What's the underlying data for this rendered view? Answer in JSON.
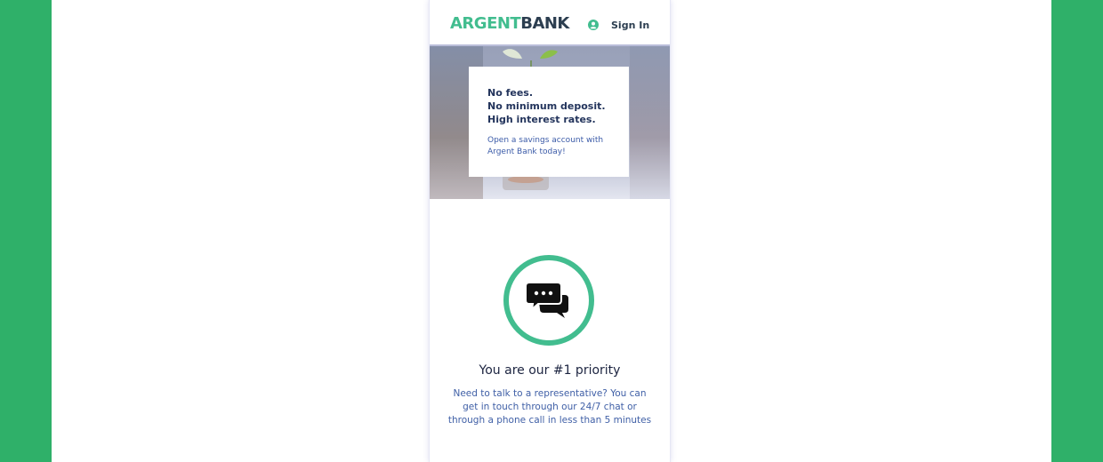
{
  "colors": {
    "frame": "#2fb069",
    "brand_green": "#42bd8f",
    "brand_dark": "#2c3e50",
    "text_dark": "#1c2440",
    "text_blue": "#3f5fa6"
  },
  "header": {
    "logo_part1": "ARGENT",
    "logo_part2": "BANK",
    "signin_icon": "user-circle-icon",
    "signin_label": "Sign In"
  },
  "hero": {
    "lines": [
      "No fees.",
      "No minimum deposit.",
      "High interest rates."
    ],
    "sub": "Open a savings account with Argent Bank today!"
  },
  "feature": {
    "icon": "chat-icon",
    "title": "You are our #1 priority",
    "text": "Need to talk to a representative? You can get in touch through our 24/7 chat or through a phone call in less than 5 minutes"
  }
}
